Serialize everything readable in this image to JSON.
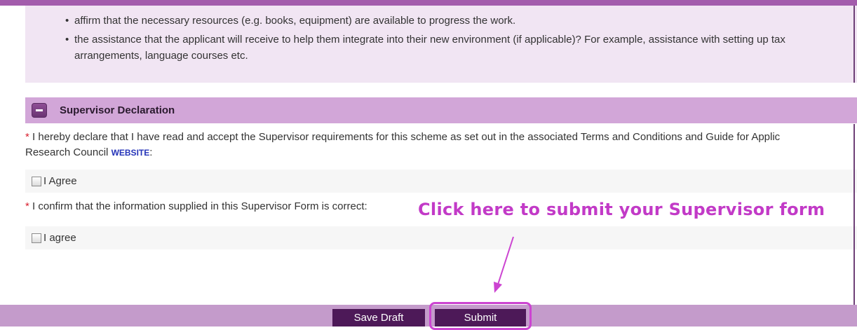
{
  "info_list": {
    "items": [
      {
        "text": "affirm that the necessary resources (e.g. books, equipment) are available to progress the work."
      },
      {
        "line1": "the assistance that the applicant will receive to help them integrate into their new environment (if applicable)? For example, assistance with setting up tax",
        "line2": "arrangements, language courses etc."
      }
    ]
  },
  "section": {
    "title": "Supervisor Declaration"
  },
  "declaration": {
    "asterisk": "*",
    "text_line1": " I hereby declare that I have read and accept the Supervisor requirements for this scheme as set out in the associated Terms and Conditions and Guide for Applic",
    "text_line2_prefix": "Research Council ",
    "link_label": "WEBSITE",
    "text_line2_suffix": ":",
    "agree_label": "I Agree"
  },
  "confirmation": {
    "asterisk": "*",
    "text": " I confirm that the information supplied in this Supervisor Form is correct:",
    "agree_label": "I agree"
  },
  "annotation": {
    "text": "Click here to submit your Supervisor form",
    "color": "#c23ac7"
  },
  "footer": {
    "save_draft_label": "Save Draft",
    "submit_label": "Submit"
  },
  "colors": {
    "accent": "#a35cac",
    "header_bg": "#d2a6d8",
    "button_bg": "#4d1958",
    "highlight": "#cc44d1"
  }
}
